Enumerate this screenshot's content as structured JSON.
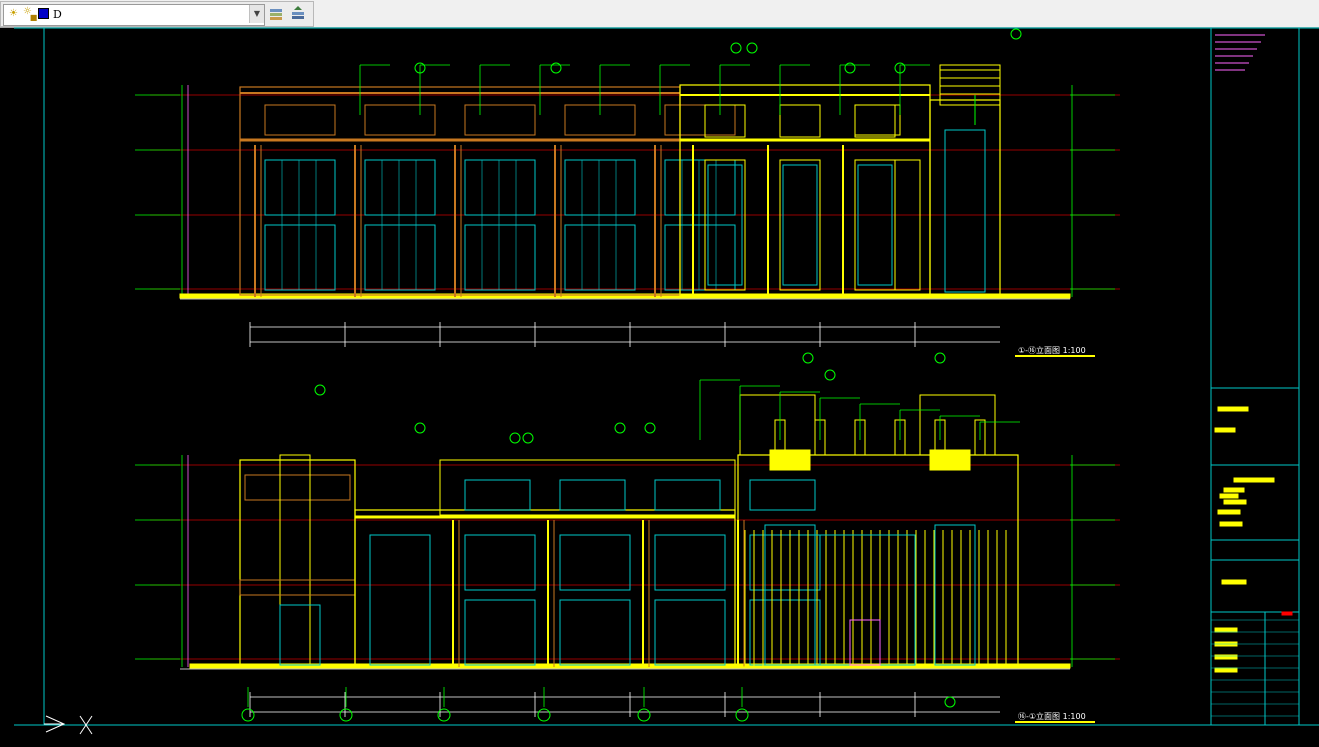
{
  "toolbar": {
    "layer_current": "D",
    "layer_icons": [
      "lightbulb-icon",
      "lock-icon",
      "color-swatch-icon"
    ],
    "buttons": [
      "layer-properties-icon",
      "layer-previous-icon"
    ]
  },
  "colors": {
    "background": "#000000",
    "frame": "#00c8c8",
    "grid": "#c80000",
    "structure": "#ffff00",
    "dim": "#00ff00",
    "text": "#ffffff",
    "note": "#ff66ff"
  },
  "drawing": {
    "upper_title": "①-⑯立面图  1:100",
    "lower_title": "⑯-①立面图  1:100"
  }
}
